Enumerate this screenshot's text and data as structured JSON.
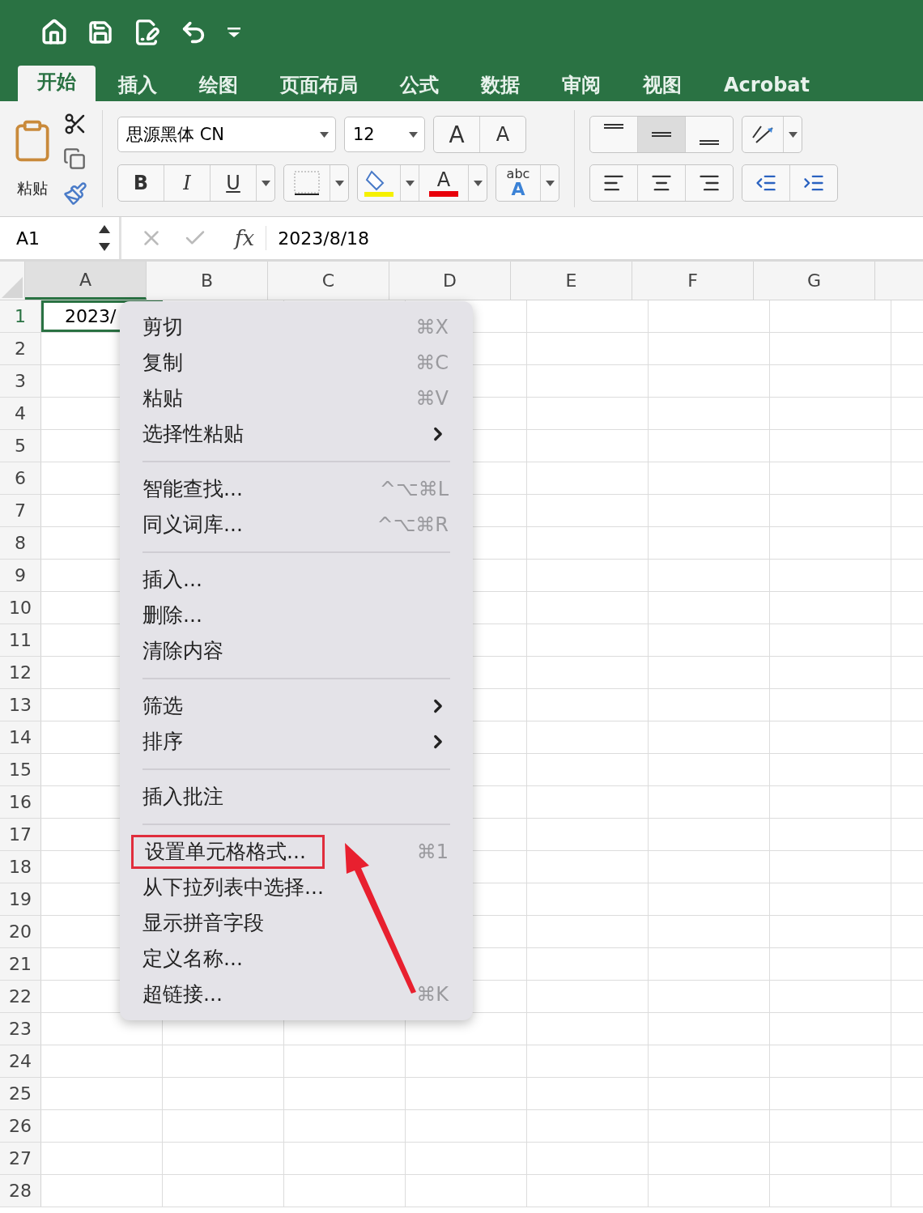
{
  "tabs": [
    {
      "label": "开始",
      "selected": true
    },
    {
      "label": "插入",
      "selected": false
    },
    {
      "label": "绘图",
      "selected": false
    },
    {
      "label": "页面布局",
      "selected": false
    },
    {
      "label": "公式",
      "selected": false
    },
    {
      "label": "数据",
      "selected": false
    },
    {
      "label": "审阅",
      "selected": false
    },
    {
      "label": "视图",
      "selected": false
    },
    {
      "label": "Acrobat",
      "selected": false
    }
  ],
  "ribbon": {
    "paste_label": "粘贴",
    "font_name": "思源黑体 CN",
    "font_size": "12",
    "grow_label": "A",
    "shrink_label": "A",
    "bold_label": "B",
    "italic_label": "I",
    "underline_label": "U",
    "font_color_label": "A",
    "text_effect_top": "abc",
    "text_effect_bottom": "A",
    "vertical_align": [
      {
        "selected": false
      },
      {
        "selected": true
      },
      {
        "selected": false
      }
    ]
  },
  "formula_bar": {
    "name_box": "A1",
    "function_label": "fx",
    "value": "2023/8/18"
  },
  "grid": {
    "columns": [
      {
        "label": "A",
        "selected": true
      },
      {
        "label": "B",
        "selected": false
      },
      {
        "label": "C",
        "selected": false
      },
      {
        "label": "D",
        "selected": false
      },
      {
        "label": "E",
        "selected": false
      },
      {
        "label": "F",
        "selected": false
      },
      {
        "label": "G",
        "selected": false
      }
    ],
    "rows": [
      {
        "label": "1",
        "selected": true
      },
      {
        "label": "2",
        "selected": false
      },
      {
        "label": "3",
        "selected": false
      },
      {
        "label": "4",
        "selected": false
      },
      {
        "label": "5",
        "selected": false
      },
      {
        "label": "6",
        "selected": false
      },
      {
        "label": "7",
        "selected": false
      },
      {
        "label": "8",
        "selected": false
      },
      {
        "label": "9",
        "selected": false
      },
      {
        "label": "10",
        "selected": false
      },
      {
        "label": "11",
        "selected": false
      },
      {
        "label": "12",
        "selected": false
      },
      {
        "label": "13",
        "selected": false
      },
      {
        "label": "14",
        "selected": false
      },
      {
        "label": "15",
        "selected": false
      },
      {
        "label": "16",
        "selected": false
      },
      {
        "label": "17",
        "selected": false
      },
      {
        "label": "18",
        "selected": false
      },
      {
        "label": "19",
        "selected": false
      },
      {
        "label": "20",
        "selected": false
      },
      {
        "label": "21",
        "selected": false
      },
      {
        "label": "22",
        "selected": false
      },
      {
        "label": "23",
        "selected": false
      },
      {
        "label": "24",
        "selected": false
      },
      {
        "label": "25",
        "selected": false
      },
      {
        "label": "26",
        "selected": false
      },
      {
        "label": "27",
        "selected": false
      },
      {
        "label": "28",
        "selected": false
      }
    ],
    "cell_a1": "2023/"
  },
  "context_menu": {
    "groups": [
      [
        {
          "label": "剪切",
          "shortcut": "⌘X",
          "submenu": false,
          "highlighted": false
        },
        {
          "label": "复制",
          "shortcut": "⌘C",
          "submenu": false,
          "highlighted": false
        },
        {
          "label": "粘贴",
          "shortcut": "⌘V",
          "submenu": false,
          "highlighted": false
        },
        {
          "label": "选择性粘贴",
          "submenu": true,
          "highlighted": false
        }
      ],
      [
        {
          "label": "智能查找...",
          "shortcut": "^⌥⌘L",
          "submenu": false,
          "highlighted": false
        },
        {
          "label": "同义词库...",
          "shortcut": "^⌥⌘R",
          "submenu": false,
          "highlighted": false
        }
      ],
      [
        {
          "label": "插入...",
          "submenu": false,
          "highlighted": false
        },
        {
          "label": "删除...",
          "submenu": false,
          "highlighted": false
        },
        {
          "label": "清除内容",
          "submenu": false,
          "highlighted": false
        }
      ],
      [
        {
          "label": "筛选",
          "submenu": true,
          "highlighted": false
        },
        {
          "label": "排序",
          "submenu": true,
          "highlighted": false
        }
      ],
      [
        {
          "label": "插入批注",
          "submenu": false,
          "highlighted": false
        }
      ],
      [
        {
          "label": "设置单元格格式...",
          "shortcut": "⌘1",
          "submenu": false,
          "highlighted": true
        },
        {
          "label": "从下拉列表中选择...",
          "submenu": false,
          "highlighted": false
        },
        {
          "label": "显示拼音字段",
          "submenu": false,
          "highlighted": false
        },
        {
          "label": "定义名称...",
          "submenu": false,
          "highlighted": false
        },
        {
          "label": "超链接...",
          "shortcut": "⌘K",
          "submenu": false,
          "highlighted": false
        }
      ]
    ]
  }
}
